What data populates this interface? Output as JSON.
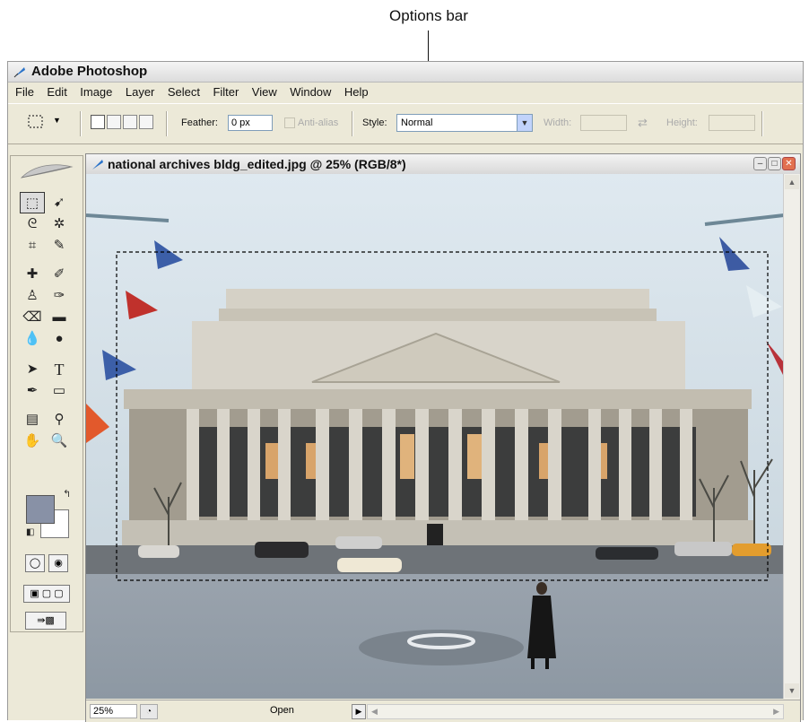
{
  "callout": {
    "label": "Options bar"
  },
  "app": {
    "title": "Adobe Photoshop"
  },
  "menu": [
    "File",
    "Edit",
    "Image",
    "Layer",
    "Select",
    "Filter",
    "View",
    "Window",
    "Help"
  ],
  "options_bar": {
    "feather_label": "Feather:",
    "feather_value": "0 px",
    "antialias_label": "Anti-alias",
    "style_label": "Style:",
    "style_value": "Normal",
    "width_label": "Width:",
    "height_label": "Height:"
  },
  "document": {
    "title": "national archives bldg_edited.jpg @ 25% (RGB/8*)"
  },
  "status": {
    "zoom": "25%",
    "info": "Open"
  },
  "colors": {
    "foreground": "#8891a6",
    "background": "#ffffff"
  }
}
